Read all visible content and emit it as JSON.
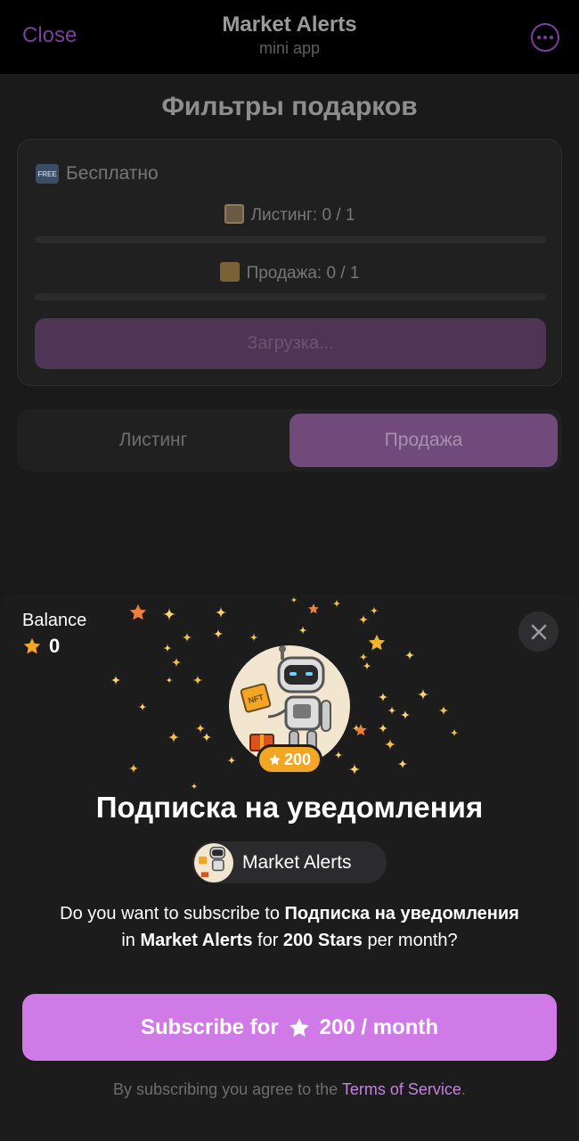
{
  "header": {
    "close_label": "Close",
    "title": "Market Alerts",
    "subtitle": "mini app",
    "more_icon": "more-dots-icon"
  },
  "app": {
    "page_title": "Фильтры подарков",
    "plan_label": "Бесплатно",
    "free_badge": "FREE",
    "listing_stat": "Листинг: 0 / 1",
    "sale_stat": "Продажа: 0 / 1",
    "listing_progress": 0,
    "sale_progress": 0,
    "loading_label": "Загрузка...",
    "tabs": [
      {
        "label": "Листинг",
        "active": false
      },
      {
        "label": "Продажа",
        "active": true
      }
    ]
  },
  "sheet": {
    "balance_label": "Balance",
    "balance_value": "0",
    "price_badge": "200",
    "title": "Подписка на уведомления",
    "bot_name": "Market Alerts",
    "description": {
      "part1": "Do you want to subscribe to ",
      "subscription": "Подписка на уведомления",
      "part2": " in ",
      "bot": "Market Alerts",
      "part3": " for ",
      "price": "200 Stars",
      "part4": " per month?"
    },
    "subscribe": {
      "prefix": "Subscribe for",
      "amount": "200 / month"
    },
    "terms": {
      "prefix": "By subscribing you agree to the ",
      "link": "Terms of Service",
      "suffix": "."
    },
    "avatar_badge": "NFT"
  },
  "colors": {
    "accent": "#d07ae8",
    "star": "#f2a623",
    "background": "#1c1c1d"
  }
}
